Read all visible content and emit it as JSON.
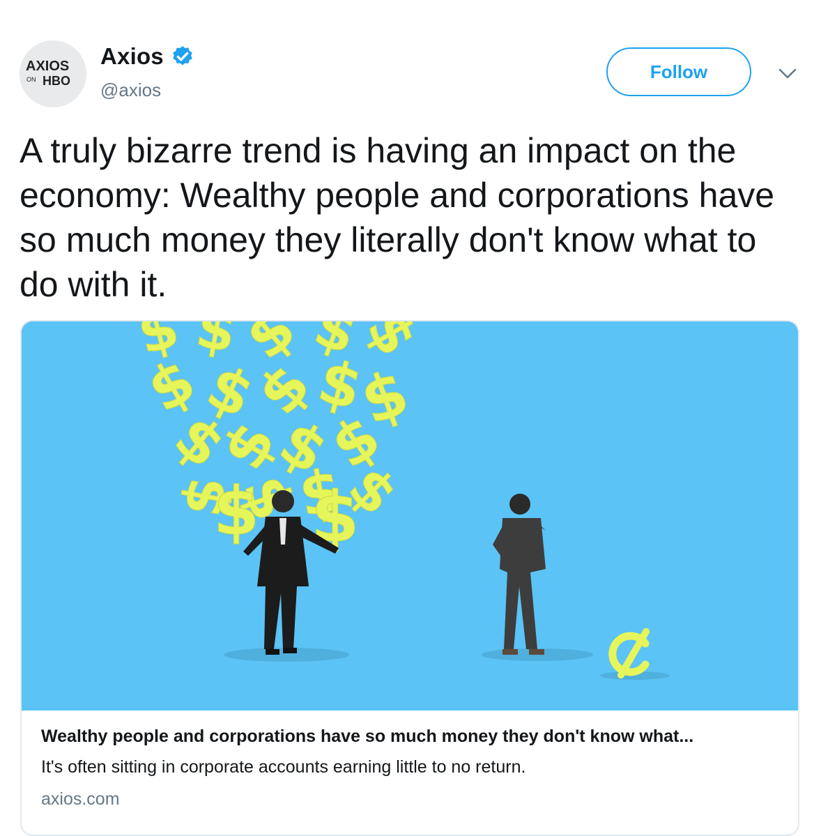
{
  "author": {
    "display_name": "Axios",
    "handle": "@axios",
    "verified": true,
    "avatar": {
      "line1": "AXIOS",
      "on": "ON",
      "hbo": "HBO"
    }
  },
  "follow_label": "Follow",
  "tweet_text": "A truly bizarre trend is having an impact on the economy: Wealthy people and corporations have so much money they literally don't know what to do with it.",
  "card": {
    "image_icon": "money-illustration",
    "title": "Wealthy people and corporations have so much money they don't know what...",
    "description": "It's often sitting in corporate accounts earning little to no return.",
    "domain": "axios.com"
  },
  "colors": {
    "accent": "#1da1f2",
    "card_image_bg": "#5bc3f5",
    "dollar_color": "#e6f55a",
    "muted_text": "#657786"
  },
  "icons": {
    "verified": "verified-badge-icon",
    "caret": "chevron-down-icon"
  }
}
